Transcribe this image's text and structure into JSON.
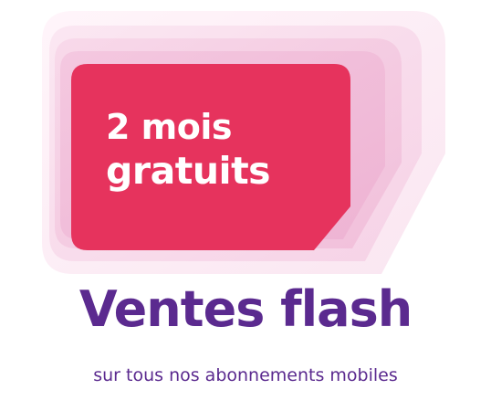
{
  "promo": {
    "line1": "2 mois",
    "line2": "gratuits"
  },
  "headline": "Ventes flash",
  "subline": "sur tous nos abonnements mobiles",
  "colors": {
    "sim_card": "#e6335d",
    "sim_layers": [
      "#fdf1f7",
      "#fae2ef",
      "#f6d0e4",
      "#f0bcd8"
    ],
    "text_purple": "#5b2a8f",
    "promo_text": "#ffffff"
  }
}
